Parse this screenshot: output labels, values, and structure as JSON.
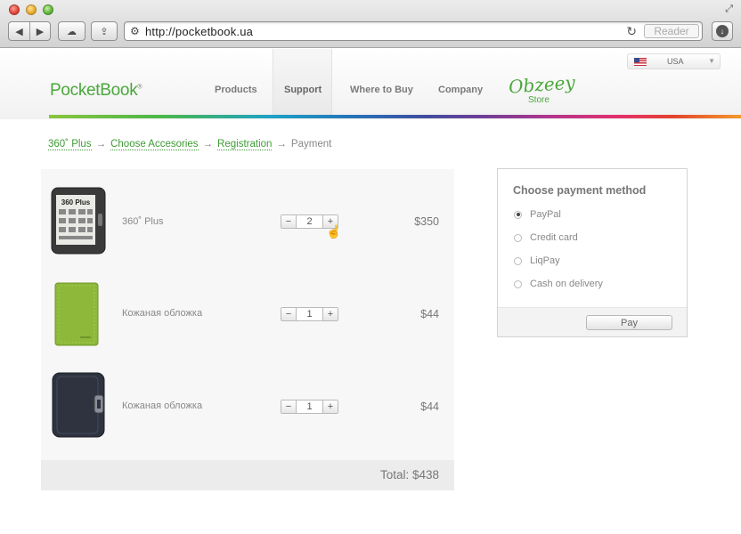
{
  "browser": {
    "url": "http://pocketbook.ua",
    "reader_label": "Reader",
    "nav_back_icon": "◀",
    "nav_forward_icon": "▶",
    "cloud_icon": "☁",
    "share_icon": "⇪",
    "globe_icon": "⚙",
    "reload_icon": "↻",
    "download_icon": "↓",
    "fullscreen_icon": "⤢"
  },
  "header": {
    "language": "USA",
    "logo": "PocketBook",
    "logo_mark": "®",
    "nav": {
      "products": "Products",
      "support": "Support",
      "where_to_buy": "Where to Buy",
      "company": "Company"
    },
    "store_logo": "Obzeey",
    "store_label": "Store",
    "colors": {
      "brand_green": "#4aa83a"
    }
  },
  "breadcrumb": {
    "step1": "360˚ Plus",
    "step2": "Choose Accesories",
    "step3": "Registration",
    "step4": "Payment",
    "separator": "→"
  },
  "cart": {
    "items": [
      {
        "name": "360˚ Plus",
        "quantity": "2",
        "price": "$350",
        "image": "pocketbook-360-plus-reader",
        "screen_text": "360 Plus"
      },
      {
        "name": "Кожаная обложка",
        "quantity": "1",
        "price": "$44",
        "image": "green-leather-cover"
      },
      {
        "name": "Кожаная обложка",
        "quantity": "1",
        "price": "$44",
        "image": "black-leather-cover"
      }
    ],
    "minus": "−",
    "plus": "+",
    "total": "Total: $438"
  },
  "payment": {
    "title": "Choose payment method",
    "options": [
      {
        "label": "PayPal",
        "checked": true
      },
      {
        "label": "Credit card",
        "checked": false
      },
      {
        "label": "LiqPay",
        "checked": false
      },
      {
        "label": "Cash on delivery",
        "checked": false
      }
    ],
    "pay_button": "Pay"
  },
  "cursor_icon": "☝"
}
